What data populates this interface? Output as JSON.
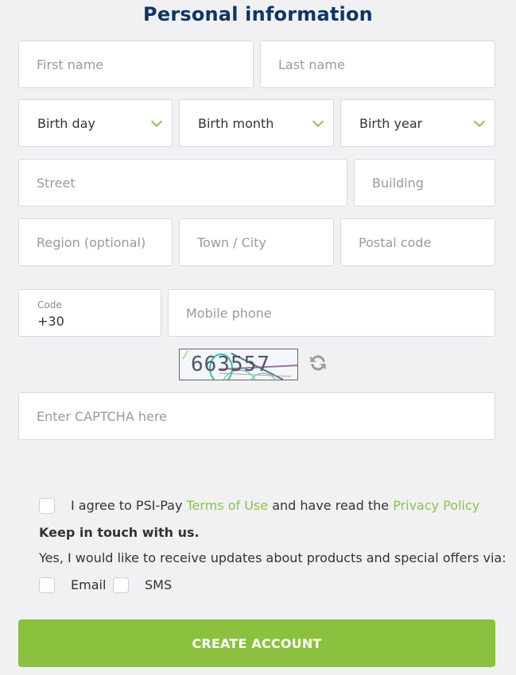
{
  "header": {
    "title": "Personal information"
  },
  "fields": {
    "first_name": {
      "placeholder": "First name",
      "value": ""
    },
    "last_name": {
      "placeholder": "Last name",
      "value": ""
    },
    "birth_day": {
      "label": "Birth day"
    },
    "birth_month": {
      "label": "Birth month"
    },
    "birth_year": {
      "label": "Birth year"
    },
    "street": {
      "placeholder": "Street",
      "value": ""
    },
    "building": {
      "placeholder": "Building",
      "value": ""
    },
    "region": {
      "placeholder": "Region (optional)",
      "value": ""
    },
    "town": {
      "placeholder": "Town / City",
      "value": ""
    },
    "postal": {
      "placeholder": "Postal code",
      "value": ""
    },
    "code": {
      "label": "Code",
      "value": "+30"
    },
    "mobile": {
      "placeholder": "Mobile phone",
      "value": ""
    },
    "captcha_input": {
      "placeholder": "Enter CAPTCHA here",
      "value": ""
    }
  },
  "captcha": {
    "text": "663557",
    "refresh_icon": "refresh-icon"
  },
  "terms": {
    "prefix": "I agree to PSI-Pay ",
    "terms_link": "Terms of Use",
    "middle": " and have read the ",
    "privacy_link": "Privacy Policy",
    "checked": false
  },
  "marketing": {
    "heading": "Keep in touch with us.",
    "description": "Yes, I would like to receive updates about products and special offers via:",
    "options": [
      {
        "label": "Email",
        "checked": false
      },
      {
        "label": "SMS",
        "checked": false
      }
    ]
  },
  "submit": {
    "label": "CREATE ACCOUNT"
  },
  "colors": {
    "accent": "#8bc34a",
    "button": "#8bc13e",
    "title": "#0f3566",
    "background": "#f1f1f4"
  }
}
